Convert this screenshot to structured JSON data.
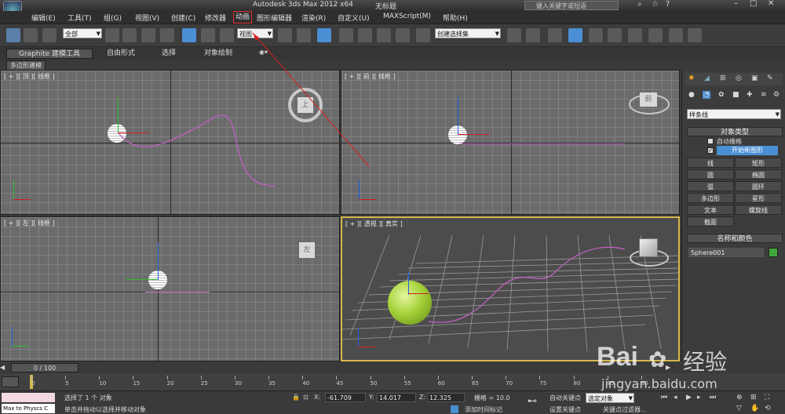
{
  "title": {
    "app": "Autodesk 3ds Max  2012 x64",
    "document": "无标题",
    "search_placeholder": "键入关键字或短语"
  },
  "menu": {
    "items": [
      "编辑(E)",
      "工具(T)",
      "组(G)",
      "视图(V)",
      "创建(C)",
      "修改器",
      "动画",
      "图形编辑器",
      "渲染(R)",
      "自定义(U)",
      "MAXScript(M)",
      "帮助(H)"
    ],
    "highlighted": "动画"
  },
  "toolbar": {
    "selection_filter": "全部",
    "reference_coord": "视图",
    "named_selection": "创建选择集"
  },
  "ribbon": {
    "tabs": [
      "Graphite 建模工具",
      "自由形式",
      "选择",
      "对象绘制"
    ],
    "sub_label": "多边形建模"
  },
  "viewports": {
    "top": "[ + ][ 顶 ][ 线框 ]",
    "front": "[ + ][ 前 ][ 线框 ]",
    "left": "[ + ][ 左 ][ 线框 ]",
    "perspective": "[ + ][ 透视 ][ 真实 ]",
    "cube_top": "上",
    "cube_front": "前",
    "cube_left": "左"
  },
  "command_panel": {
    "category_dropdown": "样条线",
    "object_type_title": "对象类型",
    "auto_grid": "自动栅格",
    "start_new_shape": "开始新图形",
    "buttons": [
      "线",
      "矩形",
      "圆",
      "椭圆",
      "弧",
      "圆环",
      "多边形",
      "星形",
      "文本",
      "螺旋线",
      "截面"
    ],
    "name_color_title": "名称和颜色",
    "object_name": "Sphere001",
    "object_color": "#3fa83a"
  },
  "timeline": {
    "frame_display": "0 / 100",
    "ticks": [
      "0",
      "5",
      "10",
      "15",
      "20",
      "25",
      "30",
      "35",
      "40",
      "45",
      "50",
      "55",
      "60",
      "65",
      "70",
      "75",
      "80",
      "85",
      "90"
    ]
  },
  "status": {
    "script_listener": "Max to Physcs C",
    "selected_text": "选择了 1 个 对象",
    "prompt_text": "单击并拖动以选择并移动对象",
    "x_label": "X:",
    "x_value": "-61.709",
    "y_label": "Y:",
    "y_value": "14.017",
    "z_label": "Z:",
    "z_value": "12.325",
    "grid_label": "栅格 = 10.0",
    "add_time_tag": "添加时间标记",
    "auto_key": "自动关键点",
    "set_key": "设置关键点",
    "selection_dropdown": "选定对象",
    "key_filters": "关键点过滤器..."
  },
  "watermark": {
    "brand": "Bai",
    "brand2": "经验",
    "url": "jingyan.baidu.com"
  }
}
